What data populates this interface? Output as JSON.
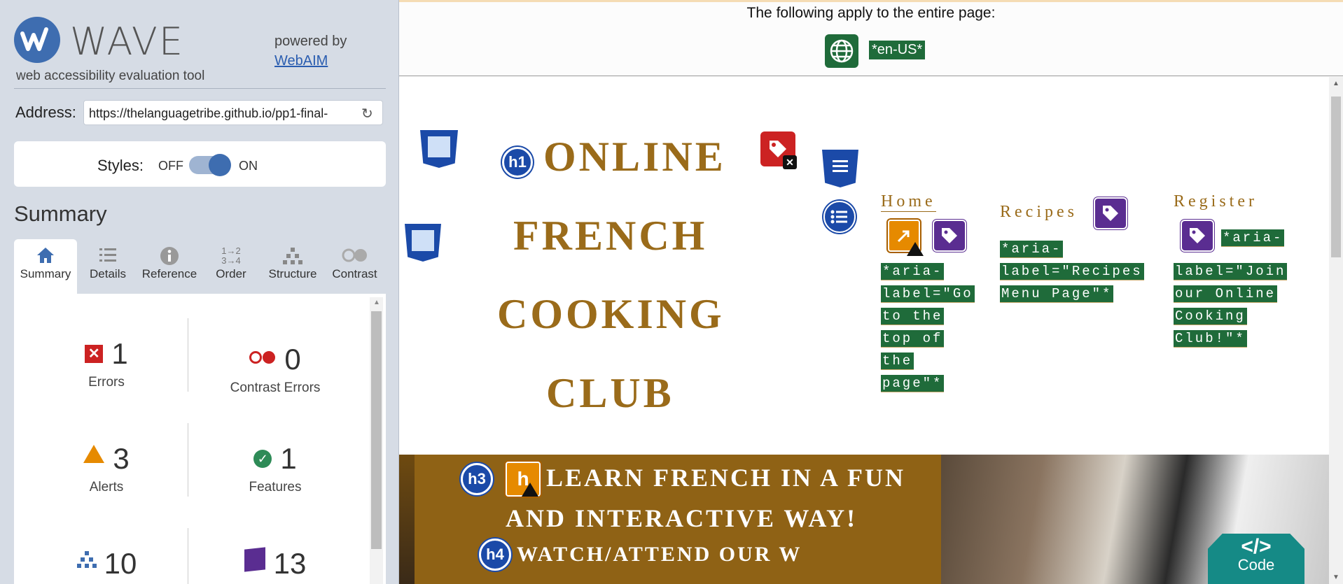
{
  "sidebar": {
    "logo_text": "WAVE",
    "logo_sub": "web accessibility evaluation tool",
    "powered_by": "powered by",
    "webaim_link": "WebAIM",
    "address_label": "Address:",
    "address_value": "https://thelanguagetribe.github.io/pp1-final-",
    "styles_label": "Styles:",
    "styles_off": "OFF",
    "styles_on": "ON",
    "styles_enabled": true,
    "summary_heading": "Summary",
    "tabs": [
      {
        "label": "Summary",
        "icon": "home-icon"
      },
      {
        "label": "Details",
        "icon": "list-icon"
      },
      {
        "label": "Reference",
        "icon": "info-icon"
      },
      {
        "label": "Order",
        "icon": "order-icon"
      },
      {
        "label": "Structure",
        "icon": "structure-icon"
      },
      {
        "label": "Contrast",
        "icon": "contrast-icon"
      }
    ],
    "stats": {
      "errors": {
        "count": "1",
        "label": "Errors"
      },
      "contrast_errors": {
        "count": "0",
        "label": "Contrast Errors"
      },
      "alerts": {
        "count": "3",
        "label": "Alerts"
      },
      "features": {
        "count": "1",
        "label": "Features"
      },
      "structural": {
        "count": "10"
      },
      "aria": {
        "count": "13"
      }
    }
  },
  "main": {
    "apply_text": "The following apply to the entire page:",
    "lang_tag": "*en-US*",
    "title_lines": [
      "ONLINE",
      "FRENCH",
      "COOKING",
      "CLUB"
    ],
    "heading_icons": {
      "h1": "h1",
      "h3": "h3",
      "h4": "h4",
      "h_alert": "h"
    },
    "nav": [
      {
        "label": "Home",
        "aria": [
          "*aria-",
          "label=\"Go",
          "to the",
          "top of",
          "the",
          "page\"*"
        ]
      },
      {
        "label": "Recipes",
        "aria": [
          "*aria-",
          "label=\"Recipes",
          "Menu Page\"*"
        ]
      },
      {
        "label": "Register",
        "aria": [
          "*aria-",
          "label=\"Join",
          "our Online",
          "Cooking",
          "Club!\"*"
        ]
      }
    ],
    "banner_line1": "LEARN FRENCH IN A FUN",
    "banner_line2": "AND INTERACTIVE WAY!",
    "banner_line3": "WATCH/ATTEND OUR W",
    "code_symbol": "</>",
    "code_label": "Code"
  },
  "colors": {
    "wave_blue": "#3e6db0",
    "error_red": "#cc2222",
    "alert_orange": "#e68a00",
    "feature_green": "#2e8b57",
    "aria_purple": "#5a2d91",
    "structure_blue": "#1b4aa8",
    "brand_gold": "#9a6b1a",
    "code_teal": "#158a86"
  }
}
